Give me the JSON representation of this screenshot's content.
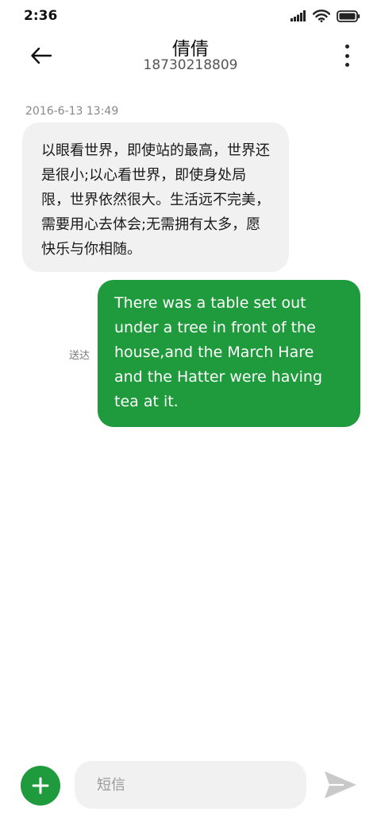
{
  "status_bar": {
    "time": "2:36",
    "icons": [
      "signal-icon",
      "wifi-icon",
      "battery-icon"
    ]
  },
  "header": {
    "contact_name": "倩倩",
    "contact_number": "18730218809",
    "back_icon": "back-arrow-icon",
    "more_icon": "more-vertical-icon"
  },
  "conversation": {
    "timestamp": "2016-6-13 13:49",
    "incoming_message": "以眼看世界，即使站的最高，世界还是很小;以心看世界，即使身处局限，世界依然很大。生活远不完美，需要用心去体会;无需拥有太多，愿快乐与你相随。",
    "outgoing_message": "There was a table set out under a tree in front of the house,and the March Hare and the Hatter were having tea at it.",
    "outgoing_status": "送达"
  },
  "composer": {
    "placeholder": "短信",
    "value": "",
    "add_icon": "plus-icon",
    "send_icon": "send-icon"
  },
  "colors": {
    "accent": "#1f9a3c",
    "incoming_bubble": "#f1f1f1",
    "input_background": "#f1f1f1",
    "send_icon": "#c9c9c9"
  }
}
